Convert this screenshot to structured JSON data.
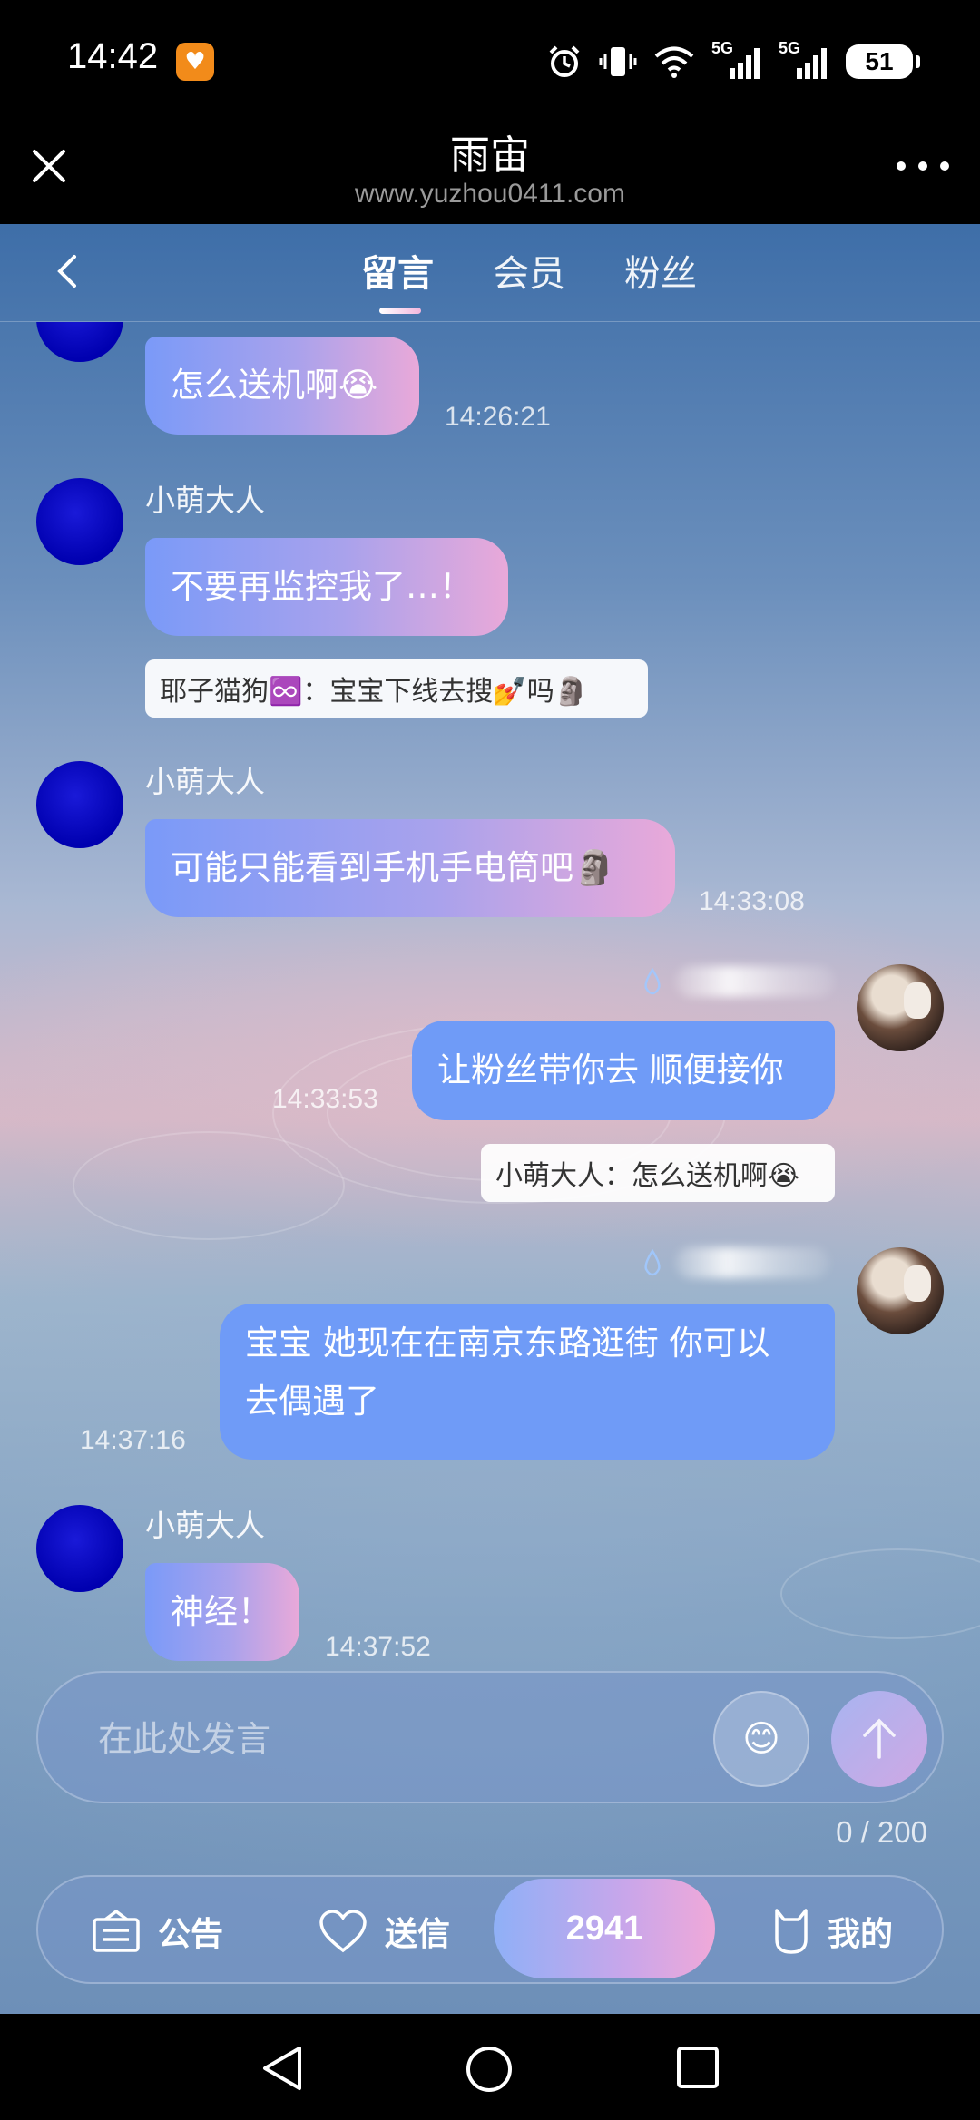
{
  "status_bar": {
    "time": "14:42",
    "network_1": "5G",
    "network_2": "5G",
    "battery": "51"
  },
  "browser": {
    "title": "雨宙",
    "url": "www.yuzhou0411.com"
  },
  "tabs": [
    {
      "label": "留言",
      "active": true
    },
    {
      "label": "会员",
      "active": false
    },
    {
      "label": "粉丝",
      "active": false
    }
  ],
  "messages": [
    {
      "sender": "",
      "text": "怎么送机啊😭",
      "time": "14:26:21",
      "direction": "in"
    },
    {
      "sender": "小萌大人",
      "text": "不要再监控我了…！",
      "quote": "耶子猫狗♾️：宝宝下线去搜💅吗🗿",
      "direction": "in"
    },
    {
      "sender": "小萌大人",
      "text": "可能只能看到手机手电筒吧🗿",
      "time": "14:33:08",
      "direction": "in"
    },
    {
      "text": "让粉丝带你去 顺便接你",
      "time": "14:33:53",
      "quote": "小萌大人：怎么送机啊😭",
      "direction": "out"
    },
    {
      "text_line1": "宝宝 她现在在南京东路逛街 你可以",
      "text_line2": "去偶遇了",
      "time": "14:37:16",
      "direction": "out"
    },
    {
      "sender": "小萌大人",
      "text": "神经！",
      "time": "14:37:52",
      "direction": "in"
    }
  ],
  "input": {
    "placeholder": "在此处发言",
    "emoji": "😊",
    "char_count": "0 / 200"
  },
  "bottom_bar": {
    "notice_label": "公告",
    "letter_label": "送信",
    "center_count": "2941",
    "mine_label": "我的"
  },
  "colors": {
    "incoming_bubble_start": "#7a9af8",
    "incoming_bubble_end": "#e9a9d9",
    "outgoing_bubble": "#6f9bf7",
    "avatar_blue": "#0000b0"
  }
}
